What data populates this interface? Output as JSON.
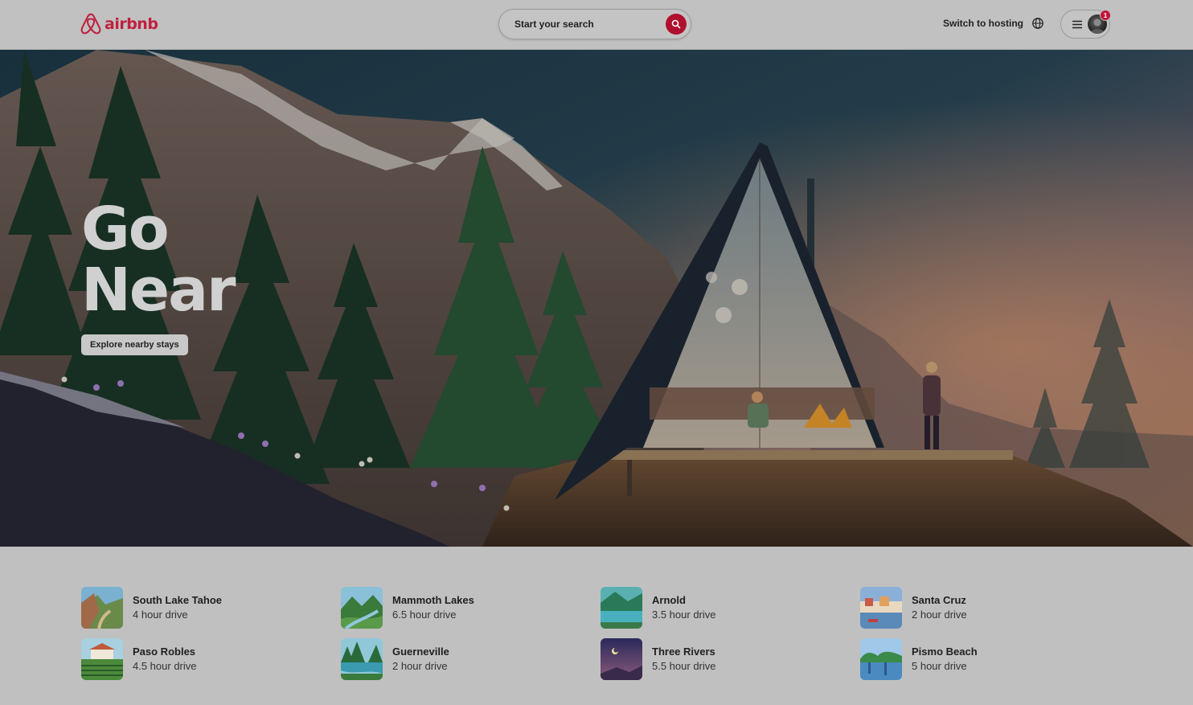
{
  "brand": {
    "name": "airbnb",
    "color": "#c0213f"
  },
  "header": {
    "search_placeholder": "Start your search",
    "switch_hosting_label": "Switch to hosting",
    "notification_count": "1"
  },
  "hero": {
    "title_line1": "Go",
    "title_line2": "Near",
    "cta_label": "Explore nearby stays"
  },
  "destinations": [
    {
      "name": "South Lake Tahoe",
      "drive": "4 hour drive"
    },
    {
      "name": "Mammoth Lakes",
      "drive": "6.5 hour drive"
    },
    {
      "name": "Arnold",
      "drive": "3.5 hour drive"
    },
    {
      "name": "Santa Cruz",
      "drive": "2 hour drive"
    },
    {
      "name": "Paso Robles",
      "drive": "4.5 hour drive"
    },
    {
      "name": "Guerneville",
      "drive": "2 hour drive"
    },
    {
      "name": "Three Rivers",
      "drive": "5.5 hour drive"
    },
    {
      "name": "Pismo Beach",
      "drive": "5 hour drive"
    }
  ],
  "icons": [
    "airbnb-logo-icon",
    "search-icon",
    "globe-icon",
    "hamburger-menu-icon",
    "avatar"
  ]
}
